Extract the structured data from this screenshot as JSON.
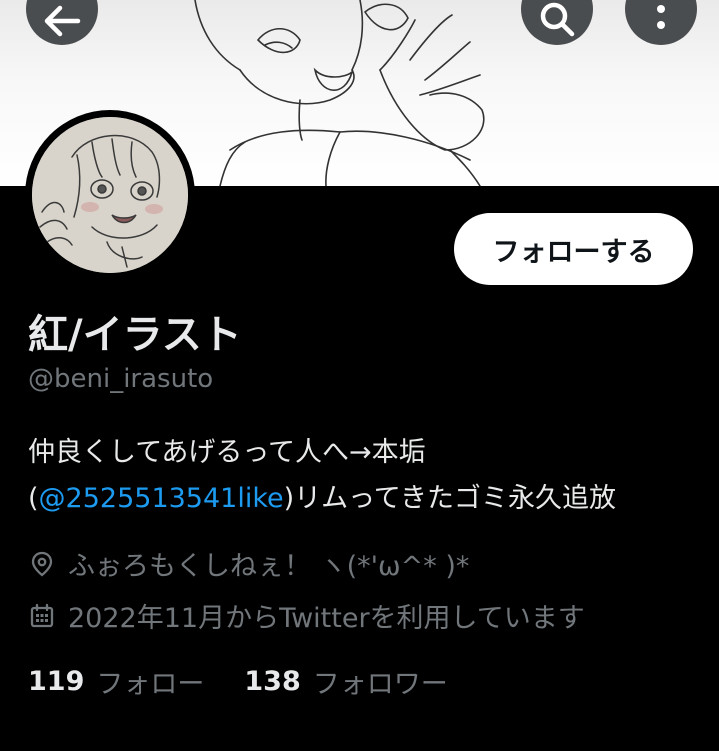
{
  "header": {
    "back_icon": "arrow-left-icon",
    "search_icon": "search-icon",
    "more_icon": "more-vertical-icon"
  },
  "profile": {
    "display_name": "紅/イラスト",
    "handle": "@beni_irasuto",
    "follow_label": "フォローする",
    "bio_line1": "仲良くしてあげるって人へ→本垢",
    "bio_open": "(",
    "bio_mention": "@2525513541like",
    "bio_rest": ")リムってきたゴミ永久追放",
    "location": "ふぉろもくしねぇ！ ヽ(*'ω^* )*",
    "joined": "2022年11月からTwitterを利用しています",
    "following_count": "119",
    "following_label": "フォロー",
    "followers_count": "138",
    "followers_label": "フォロワー"
  },
  "colors": {
    "background": "#000000",
    "text_primary": "#e7e9ea",
    "text_secondary": "#71767b",
    "link": "#1d9bf0",
    "button_bg": "#ffffff"
  }
}
